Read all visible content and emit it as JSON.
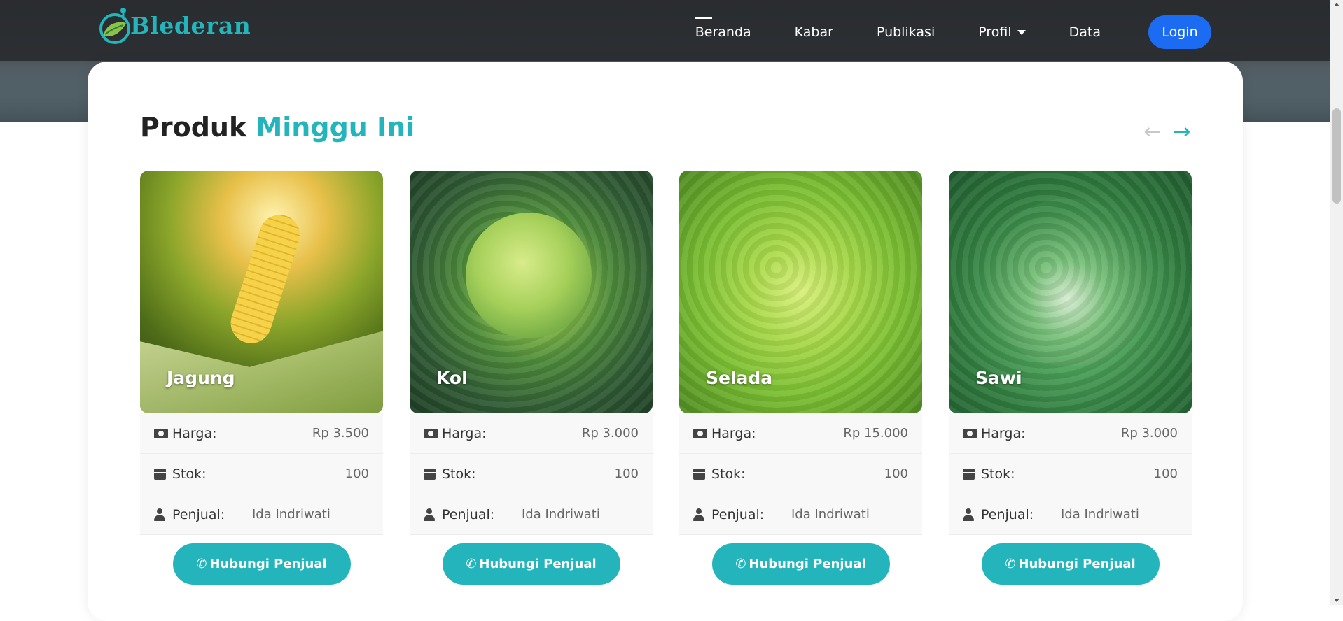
{
  "brand": {
    "name": "Blederan"
  },
  "nav": {
    "items": [
      "Beranda",
      "Kabar",
      "Publikasi",
      "Profil",
      "Data"
    ],
    "login": "Login"
  },
  "section": {
    "title_main": "Produk",
    "title_accent": "Minggu Ini"
  },
  "labels": {
    "price": "Harga:",
    "stock": "Stok:",
    "seller": "Penjual:",
    "contact": "Hubungi Penjual"
  },
  "products": [
    {
      "name": "Jagung",
      "price": "Rp 3.500",
      "stock": "100",
      "seller": "Ida Indriwati"
    },
    {
      "name": "Kol",
      "price": "Rp 3.000",
      "stock": "100",
      "seller": "Ida Indriwati"
    },
    {
      "name": "Selada",
      "price": "Rp 15.000",
      "stock": "100",
      "seller": "Ida Indriwati"
    },
    {
      "name": "Sawi",
      "price": "Rp 3.000",
      "stock": "100",
      "seller": "Ida Indriwati"
    }
  ],
  "colors": {
    "accent": "#23b5bb",
    "login": "#1b6cf2"
  }
}
